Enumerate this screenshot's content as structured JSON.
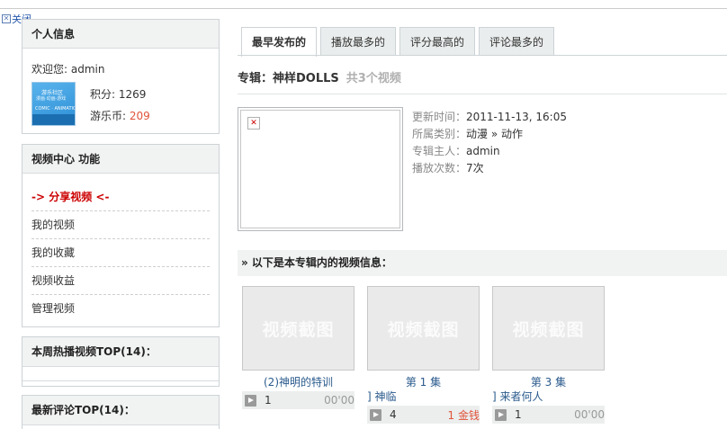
{
  "top": {
    "close_label": "关闭"
  },
  "sidebar": {
    "user_panel": {
      "title": "个人信息",
      "welcome": "欢迎您: admin",
      "points": "积分: 1269",
      "coins_label": "游乐币:",
      "coins_value": "209"
    },
    "video_panel": {
      "title": "视频中心 功能",
      "items": [
        {
          "label": "-> 分享视频 <-"
        },
        {
          "label": "我的视频"
        },
        {
          "label": "我的收藏"
        },
        {
          "label": "视频收益"
        },
        {
          "label": "管理视频"
        }
      ]
    },
    "hot_panel": {
      "title": "本周热播视频TOP(14)："
    },
    "comment_panel": {
      "title": "最新评论TOP(14)："
    }
  },
  "main": {
    "tabs": [
      {
        "label": "最早发布的",
        "active": true
      },
      {
        "label": "播放最多的"
      },
      {
        "label": "评分最高的"
      },
      {
        "label": "评论最多的"
      }
    ],
    "album": {
      "label": "专辑：神样DOLLS",
      "count": "共3个视频"
    },
    "meta": [
      {
        "key": "更新时间：",
        "value": "2011-11-13, 16:05"
      },
      {
        "key": "所属类别：",
        "value": "动漫 » 动作"
      },
      {
        "key": "专辑主人：",
        "value": "admin"
      },
      {
        "key": "播放次数：",
        "value": "7次"
      }
    ],
    "list_header": "» 以下是本专辑内的视频信息：",
    "videos": [
      {
        "thumb": "视频截图",
        "title": "(2)神明的特训",
        "subtitle": "",
        "plays": "1",
        "right": "00'00"
      },
      {
        "thumb": "视频截图",
        "title": "第 1 集",
        "subtitle": "] 神临",
        "plays": "4",
        "right": "1 金钱"
      },
      {
        "thumb": "视频截图",
        "title": "第 3 集",
        "subtitle": "] 来者何人",
        "plays": "1",
        "right": "00'00"
      }
    ]
  },
  "colors": {
    "accent_red": "#cc0000",
    "coin_orange": "#e0533a",
    "link_blue": "#2a5a8c"
  }
}
